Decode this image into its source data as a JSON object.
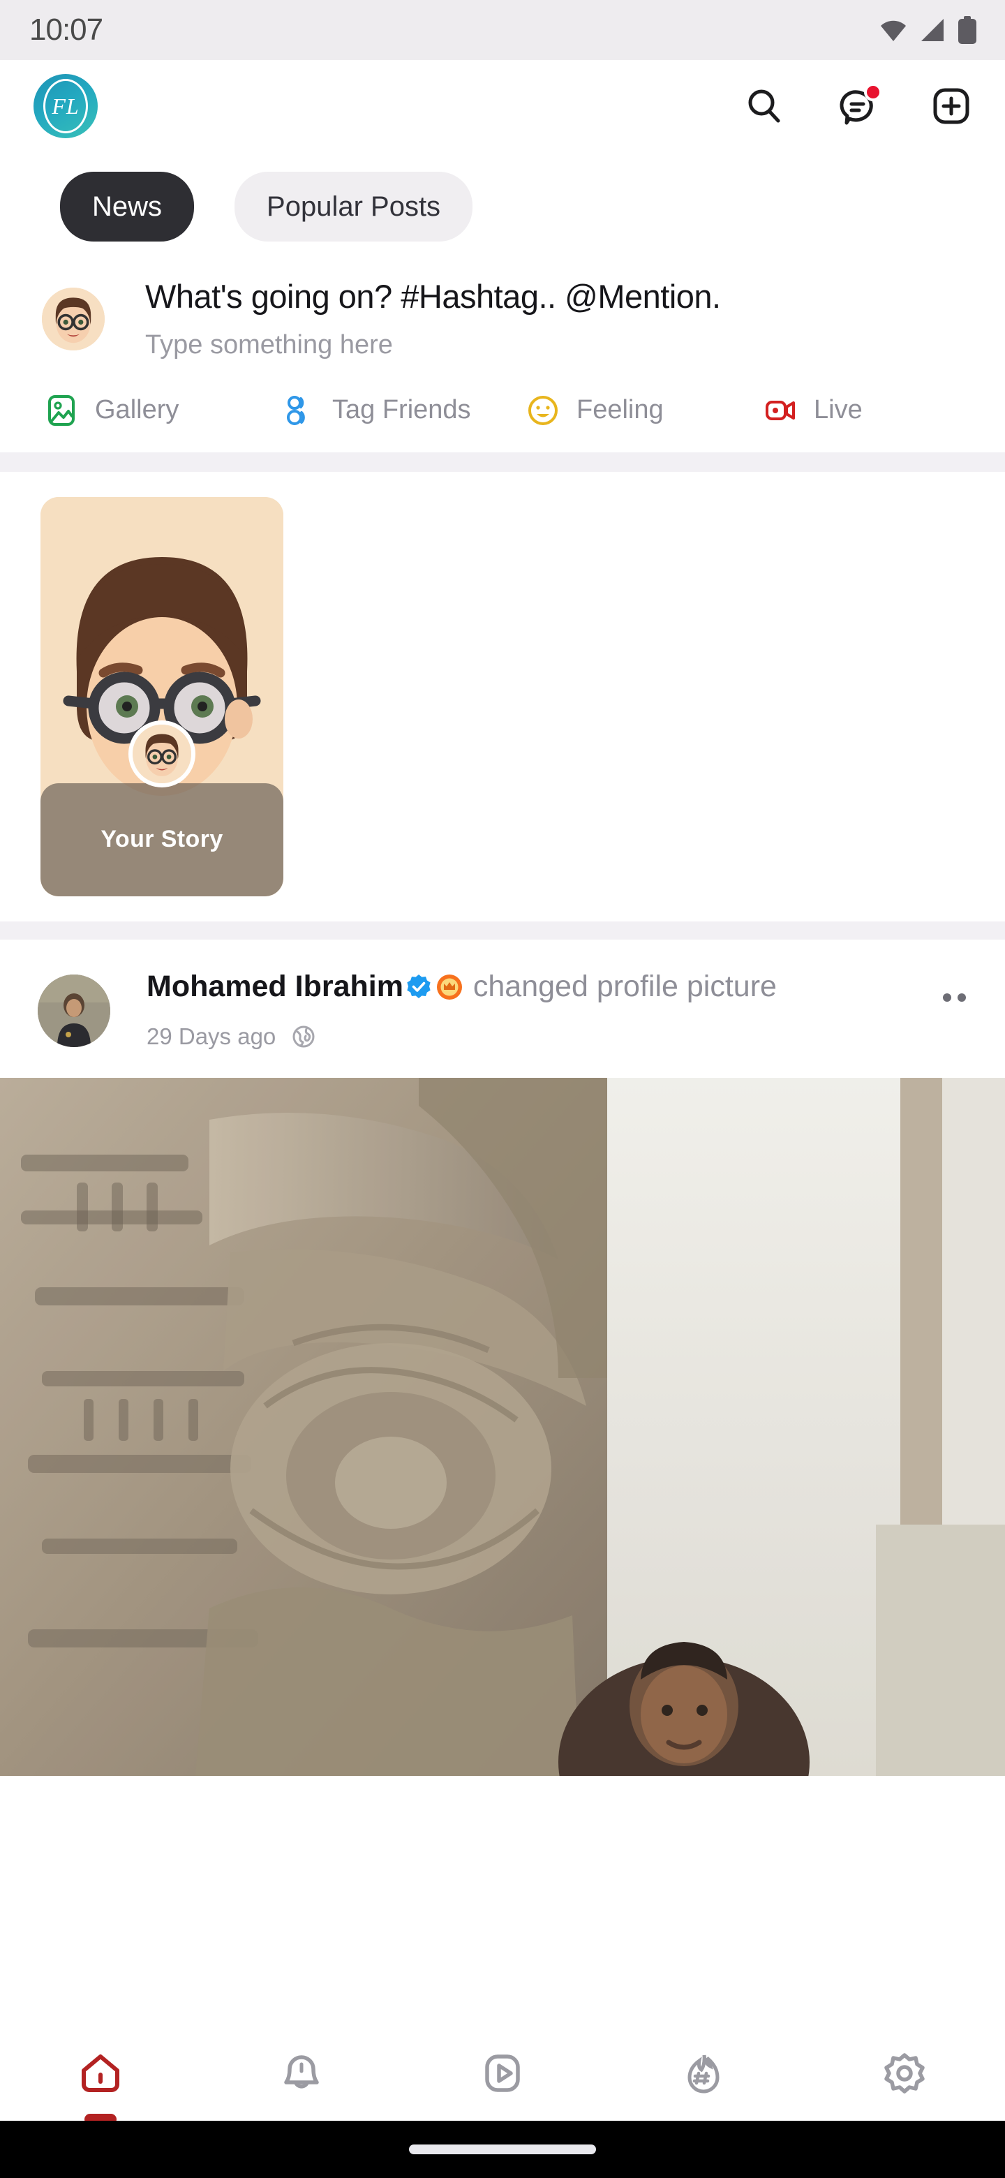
{
  "status_bar": {
    "time": "10:07",
    "icons": [
      "wifi-icon",
      "cellular-signal-icon",
      "battery-icon"
    ]
  },
  "app_header": {
    "logo_text": "FL",
    "logo_name": "app-logo",
    "actions": [
      {
        "name": "search-icon",
        "label": "Search",
        "badge": false
      },
      {
        "name": "messages-icon",
        "label": "Messages",
        "badge": true
      },
      {
        "name": "add-post-icon",
        "label": "Create",
        "badge": false
      }
    ]
  },
  "tabs": [
    {
      "label": "News",
      "active": true
    },
    {
      "label": "Popular Posts",
      "active": false
    }
  ],
  "composer": {
    "title": "What's going on? #Hashtag.. @Mention.",
    "placeholder": "Type something here",
    "actions": [
      {
        "label": "Gallery",
        "icon": "gallery-icon",
        "color": "#1fa350"
      },
      {
        "label": "Tag Friends",
        "icon": "tag-friends-icon",
        "color": "#2f97e8"
      },
      {
        "label": "Feeling",
        "icon": "feeling-icon",
        "color": "#e8b51d"
      },
      {
        "label": "Live",
        "icon": "live-icon",
        "color": "#d32020"
      }
    ]
  },
  "stories": [
    {
      "label": "Your Story",
      "name": "your-story-card"
    }
  ],
  "post": {
    "author": "Mohamed Ibrahim",
    "verified_badge": "verified-badge-icon",
    "premium_badge": "crown-badge-icon",
    "action_text": "changed profile picture",
    "timestamp": "29 Days ago",
    "privacy_icon": "globe-icon",
    "more_menu": "post-more-menu"
  },
  "bottom_nav": [
    {
      "label": "Home",
      "icon": "home-icon",
      "active": true
    },
    {
      "label": "Notifications",
      "icon": "bell-icon",
      "active": false
    },
    {
      "label": "Videos",
      "icon": "video-play-icon",
      "active": false
    },
    {
      "label": "Trending",
      "icon": "flame-hashtag-icon",
      "active": false
    },
    {
      "label": "Settings",
      "icon": "gear-icon",
      "active": false
    }
  ],
  "colors": {
    "accent_red": "#b32222",
    "badge_red": "#e8132f",
    "logo_teal": "#23a8c0",
    "tab_active_bg": "#2e2e33",
    "verified_blue": "#1d9bf0",
    "crown_orange": "#f7711d"
  }
}
